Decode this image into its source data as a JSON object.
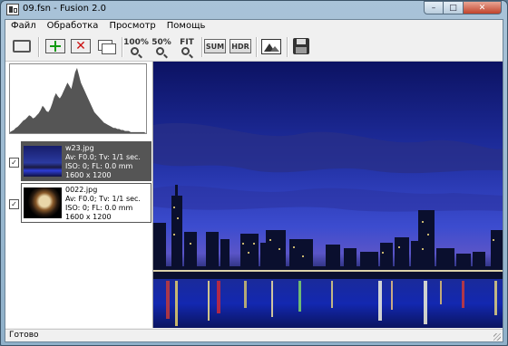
{
  "window": {
    "title": "09.fsn - Fusion 2.0",
    "min_label": "–",
    "max_label": "□",
    "close_label": "✕"
  },
  "menu": {
    "items": [
      "Файл",
      "Обработка",
      "Просмотр",
      "Помощь"
    ]
  },
  "toolbar": {
    "zoom_100": "100%",
    "zoom_50": "50%",
    "zoom_fit": "FIT",
    "sum": "SUM",
    "hdr": "HDR"
  },
  "histogram": {
    "values": [
      1,
      2,
      3,
      5,
      6,
      8,
      10,
      12,
      13,
      15,
      17,
      16,
      14,
      15,
      17,
      19,
      22,
      26,
      24,
      21,
      20,
      23,
      28,
      34,
      38,
      35,
      33,
      36,
      40,
      44,
      48,
      45,
      42,
      50,
      58,
      62,
      55,
      48,
      44,
      40,
      36,
      32,
      28,
      24,
      20,
      18,
      16,
      14,
      12,
      10,
      9,
      8,
      7,
      6,
      5,
      5,
      4,
      4,
      3,
      3,
      2,
      2,
      2,
      1,
      1,
      1,
      1,
      1,
      1,
      1,
      1,
      0
    ]
  },
  "files": [
    {
      "checked": true,
      "selected": true,
      "name": "w23.jpg",
      "exposure": "Av: F0.0; Tv: 1/1 sec.",
      "iso": "ISO: 0; FL: 0.0 mm",
      "size": "1600 x 1200"
    },
    {
      "checked": true,
      "selected": false,
      "name": "0022.jpg",
      "exposure": "Av: F0.0; Tv: 1/1 sec.",
      "iso": "ISO: 0; FL: 0.0 mm",
      "size": "1600 x 1200"
    }
  ],
  "status": {
    "text": "Готово"
  }
}
